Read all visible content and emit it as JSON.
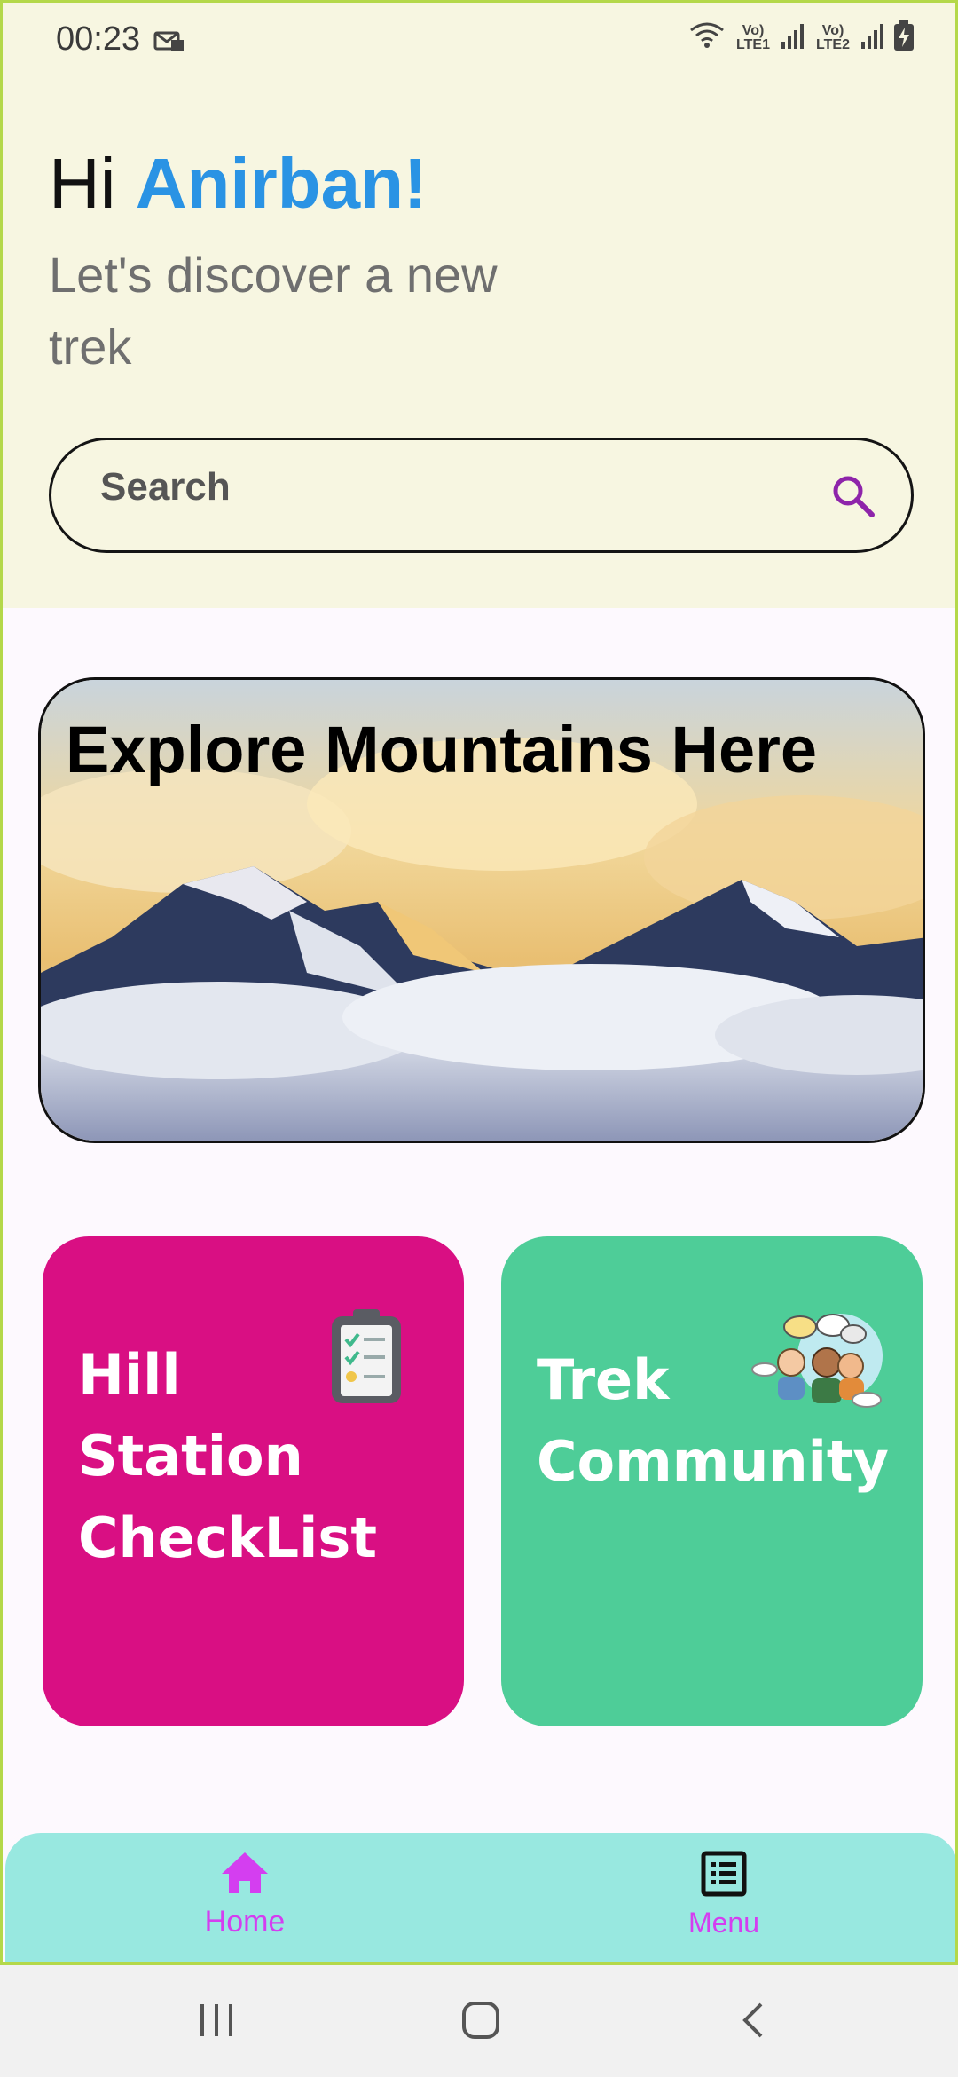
{
  "status_bar": {
    "time": "00:23",
    "sim1": "Vo) LTE1",
    "sim2": "Vo) LTE2",
    "icons": [
      "mail-icon",
      "wifi-icon",
      "signal-icon",
      "battery-charging-icon"
    ]
  },
  "greeting": {
    "prefix": "Hi ",
    "name": "Anirban!",
    "subtitle": "Let's discover a new trek"
  },
  "search": {
    "placeholder": "Search",
    "icon": "search-icon"
  },
  "banner": {
    "title": "Explore Mountains Here"
  },
  "cards": [
    {
      "title": "Hill Station CheckList",
      "icon": "clipboard-checklist-icon",
      "color": "#d90f83"
    },
    {
      "title": "Trek Community",
      "icon": "people-chat-icon",
      "color": "#4ecd98"
    }
  ],
  "bottom_nav": {
    "items": [
      {
        "label": "Home",
        "icon": "home-icon",
        "active": true
      },
      {
        "label": "Menu",
        "icon": "list-icon",
        "active": false
      }
    ]
  },
  "colors": {
    "accent_name": "#2a93e4",
    "nav_label": "#d43ef0",
    "nav_bg": "#98e8e0",
    "header_bg": "#f7f6e1"
  }
}
